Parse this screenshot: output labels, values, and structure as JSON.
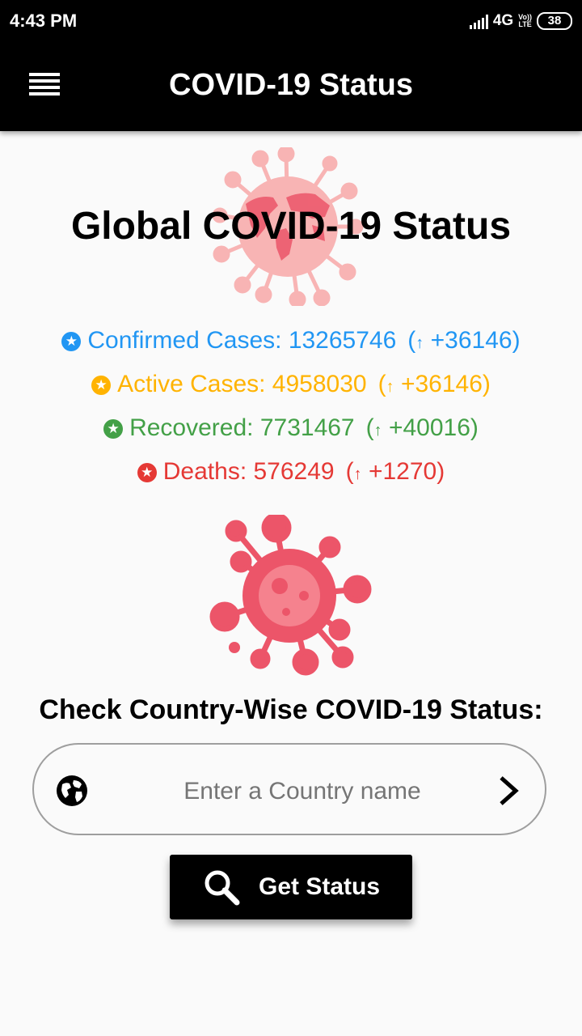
{
  "status_bar": {
    "time": "4:43 PM",
    "network": "4G",
    "volte_line1": "Vo))",
    "volte_line2": "LTE",
    "battery": "38"
  },
  "app_bar": {
    "title": "COVID-19 Status",
    "menu_icon": "menu-icon"
  },
  "global": {
    "title": "Global COVID-19 Status",
    "stats": [
      {
        "label": "Confirmed Cases: 13265746",
        "arrow": "↑",
        "delta": "+36146",
        "color": "#2196F3"
      },
      {
        "label": "Active Cases: 4958030",
        "arrow": "↑",
        "delta": "+36146",
        "color": "#FFB300"
      },
      {
        "label": "Recovered: 7731467",
        "arrow": "↑",
        "delta": "+40016",
        "color": "#43A047"
      },
      {
        "label": "Deaths: 576249",
        "arrow": "↑",
        "delta": "+1270",
        "color": "#E53935"
      }
    ]
  },
  "country": {
    "heading": "Check Country-Wise COVID-19 Status:",
    "input_placeholder": "Enter a Country name",
    "input_value": "",
    "globe_icon": "globe-icon",
    "submit_icon": "chevron-right-icon"
  },
  "button": {
    "label": "Get Status",
    "icon": "search-icon"
  },
  "colors": {
    "app_bar": "#000000",
    "background": "#fafafa",
    "virus_light": "#F8B4B4",
    "virus_main": "#EC5569"
  }
}
